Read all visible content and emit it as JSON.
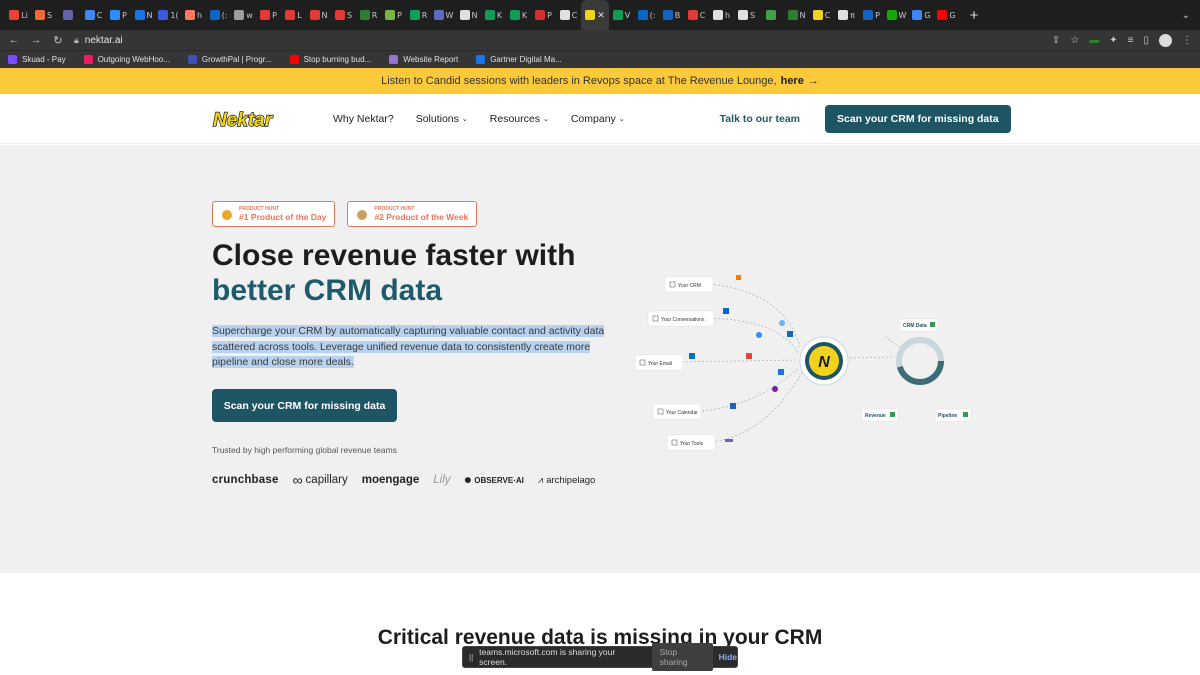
{
  "browser": {
    "tabs": [
      {
        "label": "Li",
        "icon": "gmail-icon",
        "color": "#ea4335"
      },
      {
        "label": "S",
        "icon": "chat-icon",
        "color": "#f06a35"
      },
      {
        "label": "",
        "icon": "teams-icon",
        "color": "#6264a7"
      },
      {
        "label": "C",
        "icon": "chrome-icon",
        "color": "#4285f4"
      },
      {
        "label": "P",
        "icon": "zoom-icon",
        "color": "#2d8cff"
      },
      {
        "label": "N",
        "icon": "doc-icon",
        "color": "#1a73e8"
      },
      {
        "label": "1(",
        "icon": "app-icon",
        "color": "#3b5bdb"
      },
      {
        "label": "h",
        "icon": "hubspot-icon",
        "color": "#ff7a59"
      },
      {
        "label": "(:",
        "icon": "linkedin-icon",
        "color": "#0a66c2"
      },
      {
        "label": "w",
        "icon": "globe-icon",
        "color": "#9e9e9e"
      },
      {
        "label": "P",
        "icon": "app-icon",
        "color": "#e53935"
      },
      {
        "label": "L",
        "icon": "app-icon",
        "color": "#e53935"
      },
      {
        "label": "N",
        "icon": "app-icon",
        "color": "#e53935"
      },
      {
        "label": "S",
        "icon": "app-icon",
        "color": "#e53935"
      },
      {
        "label": "R",
        "icon": "app-icon",
        "color": "#2e7d32"
      },
      {
        "label": "P",
        "icon": "app-icon",
        "color": "#7cb342"
      },
      {
        "label": "R",
        "icon": "sheets-icon",
        "color": "#0f9d58"
      },
      {
        "label": "W",
        "icon": "app-icon",
        "color": "#5c6bc0"
      },
      {
        "label": "N",
        "icon": "github-icon",
        "color": "#e0e0e0"
      },
      {
        "label": "K",
        "icon": "sheets-icon",
        "color": "#0f9d58"
      },
      {
        "label": "K",
        "icon": "sheets-icon",
        "color": "#0f9d58"
      },
      {
        "label": "P",
        "icon": "app-icon",
        "color": "#d32f2f"
      },
      {
        "label": "C",
        "icon": "g-icon",
        "color": "#e0e0e0"
      },
      {
        "label": "",
        "icon": "nektar-icon",
        "color": "#f2d31b",
        "active": true
      },
      {
        "label": "V",
        "icon": "sheets-icon",
        "color": "#0f9d58"
      },
      {
        "label": "(:",
        "icon": "linkedin-icon",
        "color": "#0a66c2"
      },
      {
        "label": "B",
        "icon": "app-icon",
        "color": "#1565c0"
      },
      {
        "label": "C",
        "icon": "app-icon",
        "color": "#e53935"
      },
      {
        "label": "h",
        "icon": "google-icon",
        "color": "#e0e0e0"
      },
      {
        "label": "S",
        "icon": "gear-icon",
        "color": "#e0e0e0"
      },
      {
        "label": "",
        "icon": "app-icon",
        "color": "#43a047"
      },
      {
        "label": "N",
        "icon": "app-icon",
        "color": "#2e7d32"
      },
      {
        "label": "C",
        "icon": "nektar-icon",
        "color": "#f2d31b"
      },
      {
        "label": "π",
        "icon": "google-icon",
        "color": "#e0e0e0"
      },
      {
        "label": "P",
        "icon": "app-icon",
        "color": "#1565c0"
      },
      {
        "label": "W",
        "icon": "upwork-icon",
        "color": "#14a800"
      },
      {
        "label": "G",
        "icon": "g-icon",
        "color": "#4285f4"
      },
      {
        "label": "G",
        "icon": "youtube-icon",
        "color": "#ff0000"
      }
    ],
    "close_glyph": "✕",
    "new_tab_glyph": "+",
    "url": "nektar.ai",
    "bookmarks": [
      {
        "label": "Skuad - Pay",
        "color": "#7c4dff"
      },
      {
        "label": "Outgoing WebHoo...",
        "color": "#e91e63"
      },
      {
        "label": "GrowthPal | Progr...",
        "color": "#3f51b5"
      },
      {
        "label": "Stop burning bud...",
        "color": "#ff0000"
      },
      {
        "label": "Website Report",
        "color": "#9575cd"
      },
      {
        "label": "Gartner Digital Ma...",
        "color": "#1a73e8"
      }
    ]
  },
  "announcement": {
    "text": "Listen to Candid sessions with leaders in Revops space at The Revenue Lounge,",
    "link": "here",
    "arrow": "→"
  },
  "nav": {
    "logo": "Nektar",
    "items": [
      {
        "label": "Why Nektar?",
        "dropdown": false
      },
      {
        "label": "Solutions",
        "dropdown": true
      },
      {
        "label": "Resources",
        "dropdown": true
      },
      {
        "label": "Company",
        "dropdown": true
      }
    ],
    "chevron": "⌄",
    "talk": "Talk to our team",
    "scan": "Scan your CRM for missing data"
  },
  "hero": {
    "badges": [
      {
        "small": "PRODUCT HUNT",
        "main": "#1 Product of the Day",
        "color": "#e8a92a"
      },
      {
        "small": "PRODUCT HUNT",
        "main": "#2 Product of the Week",
        "color": "#c9a25e"
      }
    ],
    "title_line1": "Close revenue faster with",
    "title_line2": "better CRM data",
    "subtitle": "Supercharge your CRM by automatically capturing valuable contact and activity data scattered across tools. Leverage unified revenue data to consistently create more pipeline and close more deals.",
    "cta": "Scan your CRM for missing data",
    "trusted": "Trusted by high performing global revenue teams",
    "logos": [
      "crunchbase",
      "capillary",
      "moengage",
      "Lily",
      "OBSERVE·AI",
      "archipelago"
    ]
  },
  "diagram": {
    "sources": [
      "Your CRM",
      "Your Conversations",
      "Your Email",
      "Your Calendar",
      "Your Tools"
    ],
    "center": "N",
    "outputs": [
      "CRM Data",
      "Revenue",
      "Pipeline"
    ]
  },
  "section2": {
    "title": "Critical revenue data is missing in your CRM"
  },
  "share_bar": {
    "icon": "||",
    "text": "teams.microsoft.com is sharing your screen.",
    "stop": "Stop sharing",
    "hide": "Hide"
  }
}
